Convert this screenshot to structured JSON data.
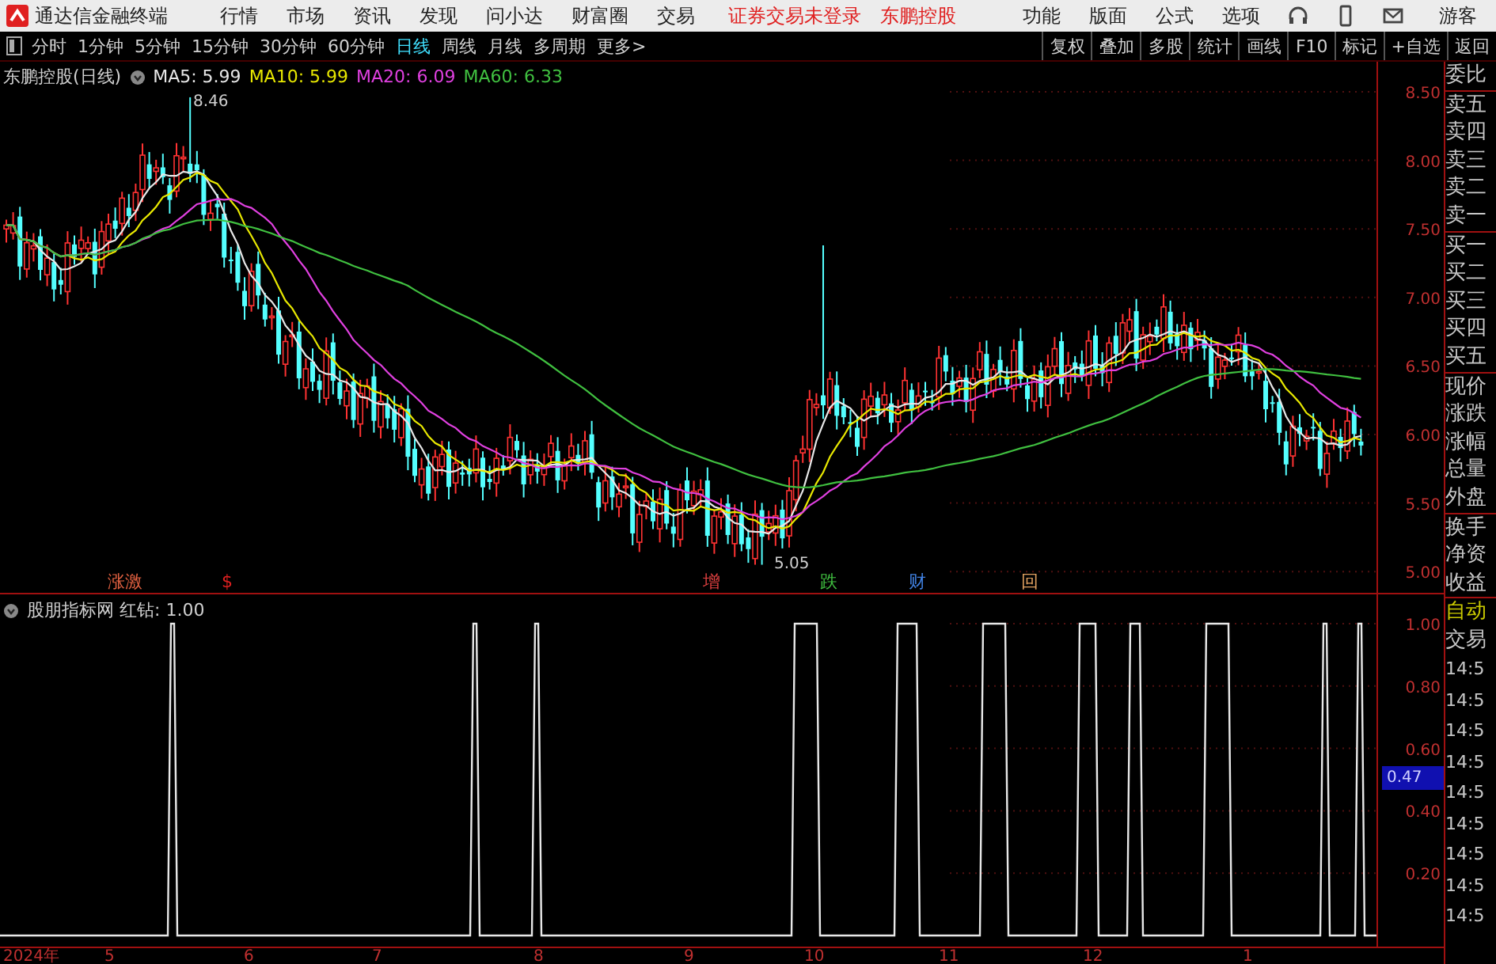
{
  "title_bar": {
    "app_name": "通达信金融终端",
    "menu": [
      "行情",
      "市场",
      "资讯",
      "发现",
      "问小达",
      "财富圈",
      "交易"
    ],
    "notices": [
      "证券交易未登录",
      "东鹏控股"
    ],
    "right_menu": [
      "功能",
      "版面",
      "公式",
      "选项"
    ],
    "user": "游客"
  },
  "toolbar": {
    "periods": [
      {
        "label": "分时",
        "selected": false
      },
      {
        "label": "1分钟",
        "selected": false
      },
      {
        "label": "5分钟",
        "selected": false
      },
      {
        "label": "15分钟",
        "selected": false
      },
      {
        "label": "30分钟",
        "selected": false
      },
      {
        "label": "60分钟",
        "selected": false
      },
      {
        "label": "日线",
        "selected": true
      },
      {
        "label": "周线",
        "selected": false
      },
      {
        "label": "月线",
        "selected": false
      },
      {
        "label": "多周期",
        "selected": false
      },
      {
        "label": "更多>",
        "selected": false
      }
    ],
    "actions": [
      "复权",
      "叠加",
      "多股",
      "统计",
      "画线",
      "F10",
      "标记",
      "+自选",
      "返回"
    ]
  },
  "price_chart": {
    "title": "东鹏控股(日线)",
    "moving_averages": [
      {
        "label": "MA5: 5.99",
        "color": "#e8e8e8"
      },
      {
        "label": "MA10: 5.99",
        "color": "#e8e800"
      },
      {
        "label": "MA20: 6.09",
        "color": "#e040e0"
      },
      {
        "label": "MA60: 6.33",
        "color": "#40c040"
      }
    ],
    "high_label": "8.46",
    "low_label": "5.05",
    "y_ticks": [
      "8.50",
      "8.00",
      "7.50",
      "7.00",
      "6.50",
      "6.00",
      "5.50",
      "5.00"
    ],
    "markers": [
      {
        "label": "涨激",
        "color": "#e06040"
      },
      {
        "label": "$",
        "color": "#e02020"
      },
      {
        "label": "增",
        "color": "#e04040"
      },
      {
        "label": "跌",
        "color": "#40c040"
      },
      {
        "label": "财",
        "color": "#4080e0"
      },
      {
        "label": "回",
        "color": "#e0a060"
      }
    ]
  },
  "indicator_panel": {
    "title": "股朋指标网 红钻: 1.00",
    "y_ticks": [
      "1.00",
      "0.80",
      "0.60",
      "0.40",
      "0.20"
    ],
    "cursor_value": "0.47"
  },
  "x_axis": [
    "2024年",
    "5",
    "6",
    "7",
    "8",
    "9",
    "10",
    "11",
    "12",
    "1"
  ],
  "quote_panel": {
    "items": [
      {
        "label": "委比",
        "highlighted": false
      },
      {
        "label": "卖五",
        "highlighted": false
      },
      {
        "label": "卖四",
        "highlighted": false
      },
      {
        "label": "卖三",
        "highlighted": false
      },
      {
        "label": "卖二",
        "highlighted": false
      },
      {
        "label": "卖一",
        "highlighted": false
      },
      {
        "label": "买一",
        "highlighted": false
      },
      {
        "label": "买二",
        "highlighted": false
      },
      {
        "label": "买三",
        "highlighted": false
      },
      {
        "label": "买四",
        "highlighted": false
      },
      {
        "label": "买五",
        "highlighted": false
      },
      {
        "label": "现价",
        "highlighted": false
      },
      {
        "label": "涨跌",
        "highlighted": false
      },
      {
        "label": "涨幅",
        "highlighted": false
      },
      {
        "label": "总量",
        "highlighted": false
      },
      {
        "label": "外盘",
        "highlighted": false
      },
      {
        "label": "换手",
        "highlighted": false
      },
      {
        "label": "净资",
        "highlighted": false
      },
      {
        "label": "收益",
        "highlighted": false
      },
      {
        "label": "自动",
        "highlighted": true
      },
      {
        "label": "交易",
        "highlighted": false
      }
    ],
    "times": [
      "14:5",
      "14:5",
      "14:5",
      "14:5",
      "14:5",
      "14:5",
      "14:5",
      "14:5",
      "14:5"
    ]
  }
}
